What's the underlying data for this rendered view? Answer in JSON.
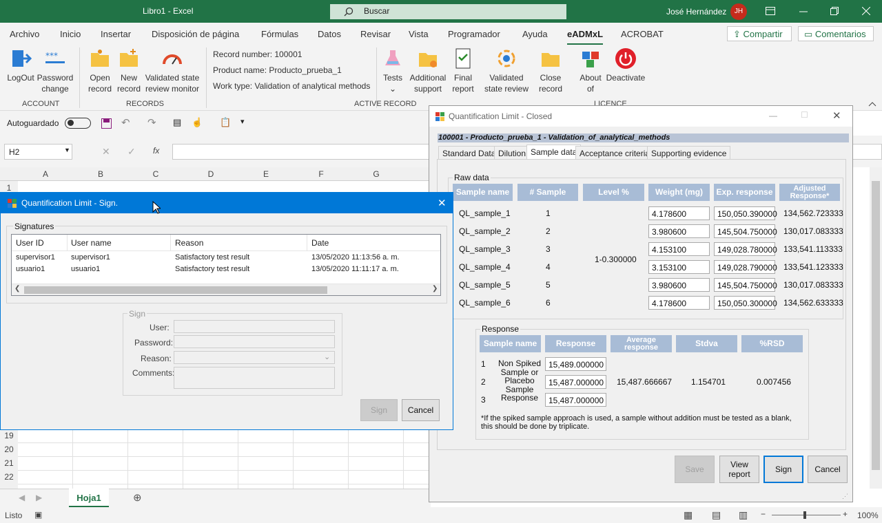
{
  "titlebar": {
    "title": "Libro1  -  Excel",
    "search": "Buscar",
    "user": "José Hernández",
    "initials": "JH"
  },
  "tabs": [
    "Archivo",
    "Inicio",
    "Insertar",
    "Disposición de página",
    "Fórmulas",
    "Datos",
    "Revisar",
    "Vista",
    "Programador",
    "Ayuda",
    "eADMxL",
    "ACROBAT"
  ],
  "top_buttons": {
    "share": "Compartir",
    "comments": "Comentarios"
  },
  "ribbon": {
    "account": {
      "label": "ACCOUNT",
      "logout": "LogOut",
      "password_1": "Password",
      "password_2": "change"
    },
    "records": {
      "label": "RECORDS",
      "open_1": "Open",
      "open_2": "record",
      "new_1": "New",
      "new_2": "record",
      "validated_1": "Validated state",
      "validated_2": "review monitor"
    },
    "active": {
      "label": "ACTIVE RECORD",
      "record_number": "Record number: 100001",
      "product_name": "Product name: Producto_prueba_1",
      "work_type": "Work type: Validation of analytical methods",
      "tests": "Tests",
      "add_1": "Additional",
      "add_2": "support",
      "final_1": "Final",
      "final_2": "report",
      "vsr_1": "Validated",
      "vsr_2": "state review",
      "close_1": "Close",
      "close_2": "record"
    },
    "licence": {
      "label": "LICENCE",
      "about_1": "About",
      "about_2": "of",
      "deactivate": "Deactivate"
    }
  },
  "qat": {
    "autosave": "Autoguardado"
  },
  "formula": {
    "namebox": "H2",
    "fx": "fx"
  },
  "grid": {
    "columns": [
      "A",
      "B",
      "C",
      "D",
      "E",
      "F",
      "G"
    ],
    "rows_top": [
      "1"
    ],
    "rows_bottom": [
      "19",
      "20",
      "21",
      "22"
    ]
  },
  "sheet": {
    "tab": "Hoja1"
  },
  "status": {
    "ready": "Listo",
    "zoom": "100%"
  },
  "ql_closed": {
    "title": "Quantification Limit  - Closed",
    "header": "100001 - Producto_prueba_1 - Validation_of_analytical_methods",
    "tabs": [
      "Standard Data",
      "Dilution",
      "Sample data",
      "Acceptance criteria",
      "Supporting evidence"
    ],
    "raw_label": "Raw data",
    "raw_headers": [
      "Sample name",
      "# Sample",
      "Level %",
      "Weight (mg)",
      "Exp. response",
      "Adjusted Response*"
    ],
    "level": "1-0.300000",
    "rows": [
      {
        "name": "QL_sample_1",
        "n": "1",
        "weight": "4.178600",
        "exp": "150,050.390000",
        "adj": "134,562.723333"
      },
      {
        "name": "QL_sample_2",
        "n": "2",
        "weight": "3.980600",
        "exp": "145,504.750000",
        "adj": "130,017.083333"
      },
      {
        "name": "QL_sample_3",
        "n": "3",
        "weight": "4.153100",
        "exp": "149,028.780000",
        "adj": "133,541.113333"
      },
      {
        "name": "QL_sample_4",
        "n": "4",
        "weight": "3.153100",
        "exp": "149,028.790000",
        "adj": "133,541.123333"
      },
      {
        "name": "QL_sample_5",
        "n": "5",
        "weight": "3.980600",
        "exp": "145,504.750000",
        "adj": "130,017.083333"
      },
      {
        "name": "QL_sample_6",
        "n": "6",
        "weight": "4.178600",
        "exp": "150,050.300000",
        "adj": "134,562.633333"
      }
    ],
    "response_label": "Response",
    "resp_headers": [
      "Sample name",
      "Response",
      "Average response",
      "Stdva",
      "%RSD"
    ],
    "resp_name": "Non Spiked Sample or Placebo Sample Response",
    "resp_rows": [
      {
        "n": "1",
        "value": "15,489.000000"
      },
      {
        "n": "2",
        "value": "15,487.000000"
      },
      {
        "n": "3",
        "value": "15,487.000000"
      }
    ],
    "average": "15,487.666667",
    "stdva": "1.154701",
    "rsd": "0.007456",
    "note": "*If the spiked sample approach is used, a sample without addition must be tested as a blank, this should be done by triplicate.",
    "buttons": {
      "save": "Save",
      "view_1": "View",
      "view_2": "report",
      "sign": "Sign",
      "cancel": "Cancel"
    }
  },
  "ql_sign": {
    "title": "Quantification Limit - Sign.",
    "signatures_label": "Signatures",
    "headers": [
      "User ID",
      "User name",
      "Reason",
      "Date"
    ],
    "rows": [
      {
        "id": "supervisor1",
        "name": "supervisor1",
        "reason": "Satisfactory test result",
        "date": "13/05/2020 11:13:56 a. m."
      },
      {
        "id": "usuario1",
        "name": "usuario1",
        "reason": "Satisfactory test result",
        "date": "13/05/2020 11:11:17 a. m."
      }
    ],
    "sign_label": "Sign",
    "labels": {
      "user": "User:",
      "password": "Password:",
      "reason": "Reason:",
      "comments": "Comments:"
    },
    "buttons": {
      "sign": "Sign",
      "cancel": "Cancel"
    }
  }
}
